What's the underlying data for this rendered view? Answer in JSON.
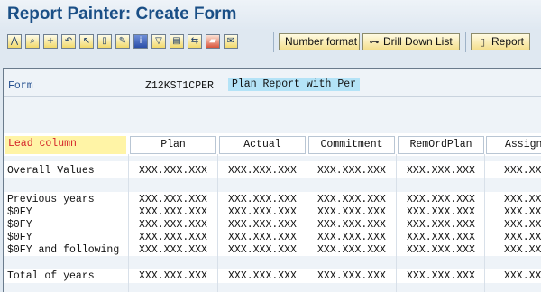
{
  "window": {
    "title": "Report Painter: Create Form"
  },
  "toolbar": {
    "icons": [
      "pyramid-icon",
      "find-icon",
      "find-next-icon",
      "undo-icon",
      "select-icon",
      "delete-icon",
      "edit-icon",
      "info-icon",
      "filter-icon",
      "variables-icon",
      "expand-icon",
      "transport-icon",
      "notes-icon"
    ],
    "number_format_label": "Number format",
    "drill_down_label": "Drill Down List",
    "report_label": "Report"
  },
  "form": {
    "label": "Form",
    "id": "Z12KST1CPER",
    "description": "Plan Report with Per"
  },
  "grid": {
    "lead_column_label": "Lead column",
    "columns": [
      "Plan",
      "Actual",
      "Commitment",
      "RemOrdPlan",
      "Assign"
    ],
    "rows": [
      {
        "label": "Overall Values",
        "values": [
          "XXX.XXX.XXX",
          "XXX.XXX.XXX",
          "XXX.XXX.XXX",
          "XXX.XXX.XXX",
          "XXX.XXX.XXX"
        ]
      },
      {
        "label": "Previous years",
        "values": [
          "XXX.XXX.XXX",
          "XXX.XXX.XXX",
          "XXX.XXX.XXX",
          "XXX.XXX.XXX",
          "XXX.XXX.XXX"
        ]
      },
      {
        "label": "$0FY",
        "values": [
          "XXX.XXX.XXX",
          "XXX.XXX.XXX",
          "XXX.XXX.XXX",
          "XXX.XXX.XXX",
          "XXX.XXX.XXX"
        ]
      },
      {
        "label": "$0FY",
        "values": [
          "XXX.XXX.XXX",
          "XXX.XXX.XXX",
          "XXX.XXX.XXX",
          "XXX.XXX.XXX",
          "XXX.XXX.XXX"
        ]
      },
      {
        "label": "$0FY",
        "values": [
          "XXX.XXX.XXX",
          "XXX.XXX.XXX",
          "XXX.XXX.XXX",
          "XXX.XXX.XXX",
          "XXX.XXX.XXX"
        ]
      },
      {
        "label": "$0FY and following",
        "values": [
          "XXX.XXX.XXX",
          "XXX.XXX.XXX",
          "XXX.XXX.XXX",
          "XXX.XXX.XXX",
          "XXX.XXX.XXX"
        ]
      },
      {
        "label": "Total of years",
        "values": [
          "XXX.XXX.XXX",
          "XXX.XXX.XXX",
          "XXX.XXX.XXX",
          "XXX.XXX.XXX",
          "XXX.XXX.XXX"
        ]
      }
    ]
  }
}
